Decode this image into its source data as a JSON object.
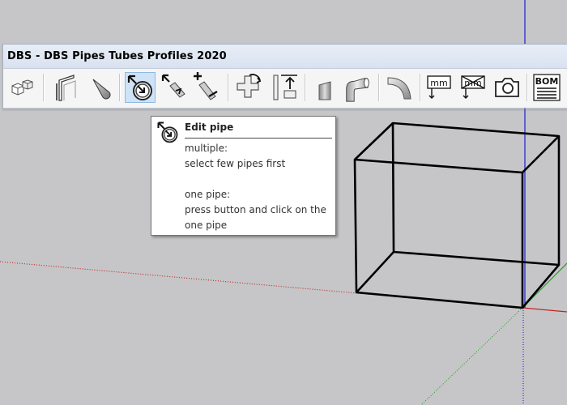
{
  "toolbar": {
    "title": "DBS - DBS Pipes Tubes Profiles 2020",
    "buttons": [
      {
        "name": "blocks-tool-button",
        "icon": "boxes-icon"
      },
      {
        "name": "profile-tool-button",
        "icon": "profile-icon"
      },
      {
        "name": "cone-tool-button",
        "icon": "cone-icon"
      },
      {
        "name": "edit-pipe-button",
        "icon": "edit-pipe-icon",
        "active": true
      },
      {
        "name": "rotate-pipe-button",
        "icon": "rotate-pipe-icon"
      },
      {
        "name": "add-remove-pipe-button",
        "icon": "add-remove-pipe-icon"
      },
      {
        "name": "cross-joint-button",
        "icon": "cross-joint-icon"
      },
      {
        "name": "align-up-button",
        "icon": "align-up-icon"
      },
      {
        "name": "pipe-cut-button",
        "icon": "pipe-cut-icon"
      },
      {
        "name": "elbow-pipe-button",
        "icon": "elbow-pipe-icon"
      },
      {
        "name": "bend-pipe-button",
        "icon": "bend-pipe-icon"
      },
      {
        "name": "dimension-mm-button",
        "icon": "mm-icon",
        "label": "mm"
      },
      {
        "name": "dimension-mm-remove-button",
        "icon": "mm-crossed-icon",
        "label": "mm"
      },
      {
        "name": "camera-button",
        "icon": "camera-icon"
      },
      {
        "name": "bom-button",
        "icon": "bom-icon",
        "label": "BOM"
      }
    ]
  },
  "tooltip": {
    "icon": "edit-pipe-icon",
    "title": "Edit pipe",
    "lines": [
      "multiple:",
      "select few pipes first",
      "",
      "one pipe:",
      "press button and click on the",
      "one pipe"
    ]
  },
  "colors": {
    "background": "#c6c6c8",
    "axis_blue": "#2a2ad6",
    "axis_red": "#c42020",
    "axis_green": "#22a022",
    "toolbar_bg": "#f5f5f5",
    "titlebar_bg": "#dfe7f2",
    "active_button": "#cfe3f7"
  }
}
